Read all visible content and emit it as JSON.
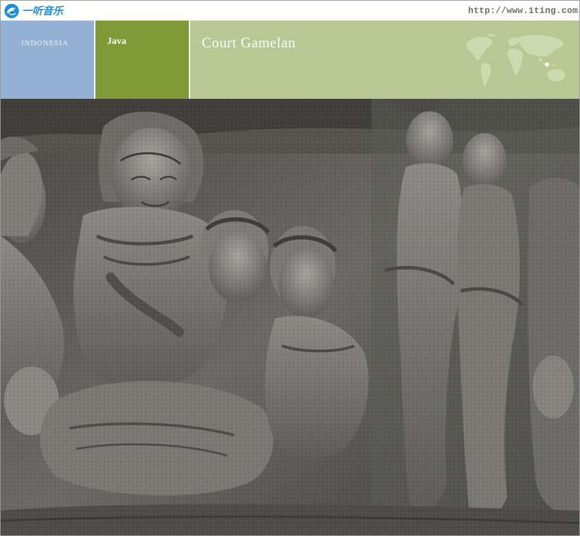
{
  "brand": {
    "logo_text": "一听音乐",
    "url": "http://www.1ting.com",
    "accent_color": "#1f8fd4"
  },
  "header": {
    "region": "INDONESIA",
    "country": "Java",
    "title": "Court Gamelan",
    "panel_colors": {
      "region": "#93b1d2",
      "country": "#7d9a36",
      "title": "#b8c894"
    },
    "map_icon": "world-map-icon"
  },
  "hero": {
    "image_icon": "stone-relief-photo"
  }
}
